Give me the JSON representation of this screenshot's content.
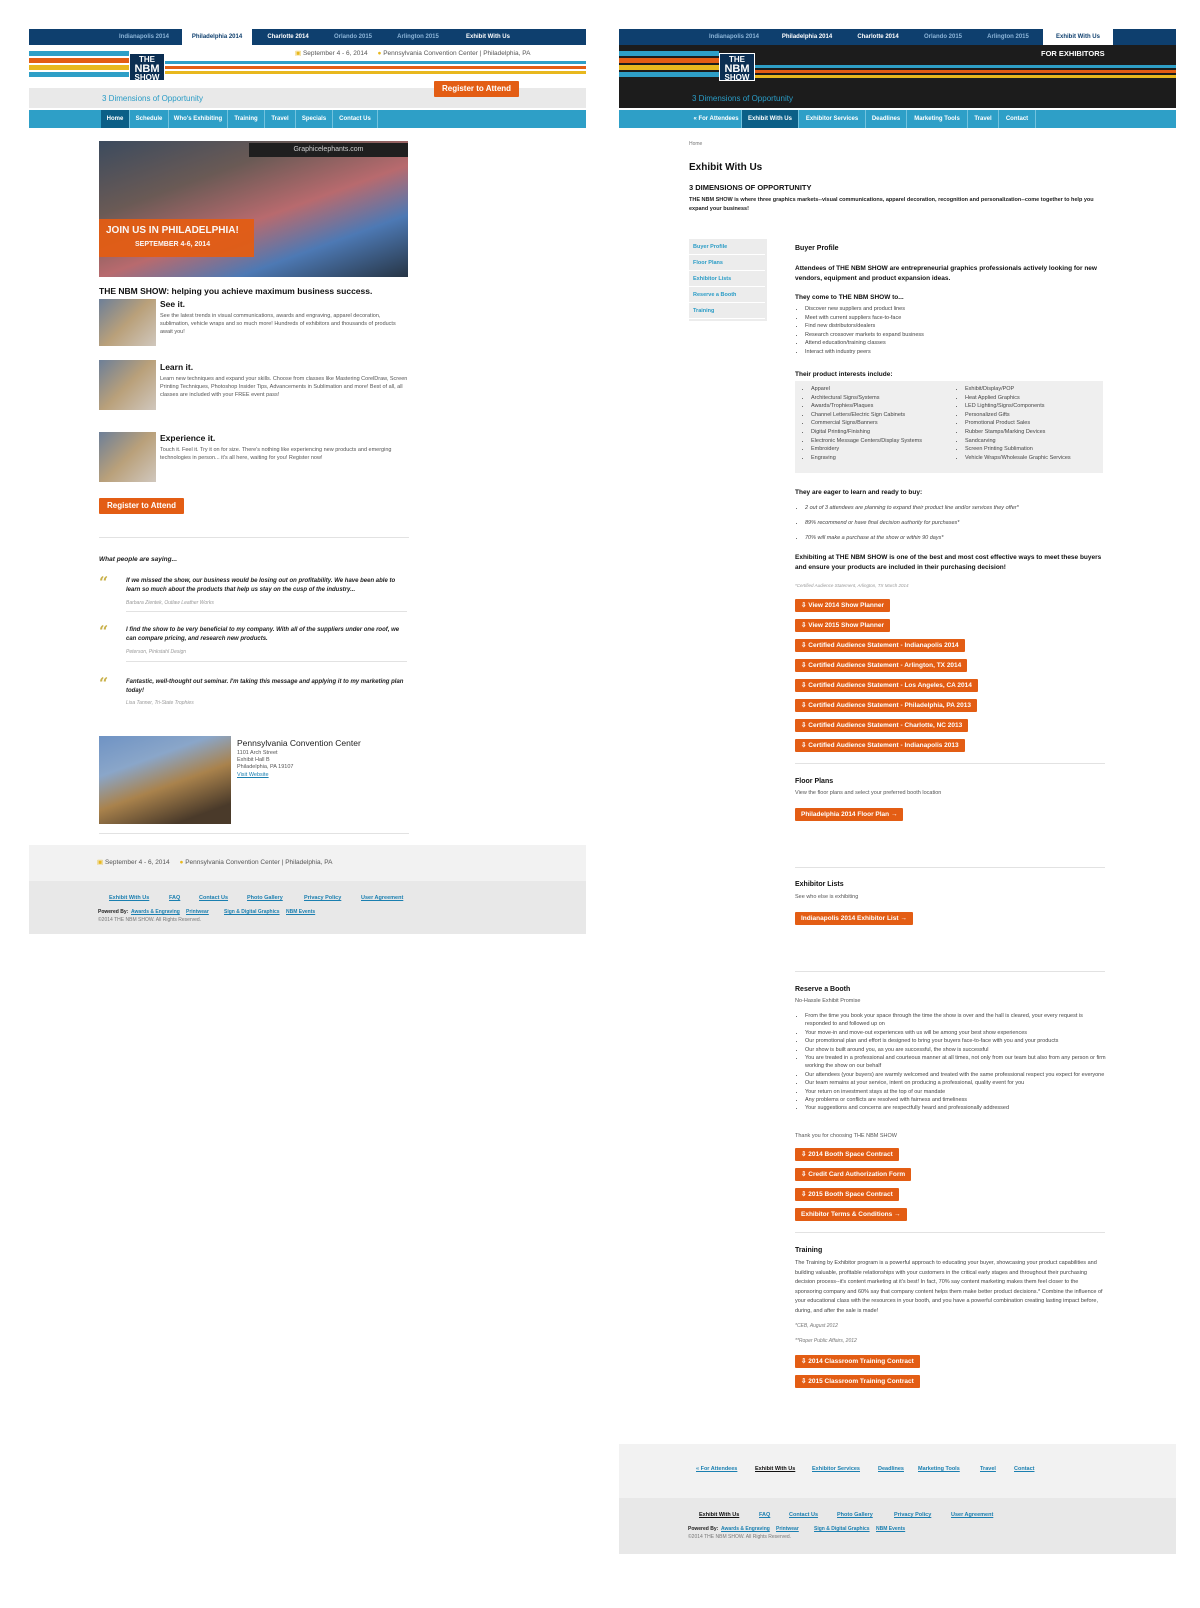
{
  "left": {
    "top_tabs": [
      "Indianapolis 2014",
      "Philadelphia 2014",
      "Charlotte 2014",
      "Orlando 2015",
      "Arlington 2015",
      "Exhibit With Us"
    ],
    "event_date": "September 4 - 6, 2014",
    "event_venue": "Pennsylvania Convention Center | Philadelphia, PA",
    "register_button": "Register to Attend",
    "tagline": "3 Dimensions of Opportunity",
    "nav": [
      "Home",
      "Schedule",
      "Who's Exhibiting",
      "Training",
      "Travel",
      "Specials",
      "Contact Us"
    ],
    "hero": {
      "line1": "JOIN US IN PHILADELPHIA!",
      "line2": "SEPTEMBER 4-6, 2014",
      "sign": "Graphicelephants.com"
    },
    "intro_heading": "THE NBM SHOW: helping you achieve maximum business success.",
    "features": [
      {
        "title": "See it.",
        "text": "See the latest trends in visual communications, awards and engraving, apparel decoration, sublimation, vehicle wraps and so much more! Hundreds of exhibitors and thousands of products await you!"
      },
      {
        "title": "Learn it.",
        "text": "Learn new techniques and expand your skills. Choose from classes like Mastering CorelDraw, Screen Printing Techniques, Photoshop Insider Tips, Advancements in Sublimation and more! Best of all, all classes are included with your FREE event pass!"
      },
      {
        "title": "Experience it.",
        "text": "Touch it. Feel it. Try it on for size. There's nothing like experiencing new products and emerging technologies in person... it's all here, waiting for you! Register now!"
      }
    ],
    "register_button_2": "Register to Attend",
    "testimonials_heading": "What people are saying...",
    "testimonials": [
      {
        "quote": "If we missed the show, our business would be losing out on profitability. We have been able to learn so much about the products that help us stay on the cusp of the industry...",
        "author": "Barbara Zientek, Outlaw Leather Works"
      },
      {
        "quote": "I find the show to be very beneficial to my company. With all of the suppliers under one roof, we can compare pricing, and research new products.",
        "author": "Peterson, Pinkstahl Design"
      },
      {
        "quote": "Fantastic, well-thought out seminar. I'm taking this message and applying it to my marketing plan today!",
        "author": "Lisa Tanner, Tri-State Trophies"
      }
    ],
    "venue": {
      "name": "Pennsylvania Convention Center",
      "address1": "1101 Arch Street",
      "address2": "Exhibit Hall B",
      "address3": "Philadelphia, PA 19107",
      "link": "Visit Website"
    },
    "footer_date": "September 4 - 6, 2014",
    "footer_venue": "Pennsylvania Convention Center | Philadelphia, PA",
    "footer_links": [
      "Exhibit With Us",
      "FAQ",
      "Contact Us",
      "Photo Gallery",
      "Privacy Policy",
      "User Agreement"
    ],
    "powered_by": "Powered By:",
    "powered_links": [
      "Awards & Engraving",
      "Printwear",
      "Sign & Digital Graphics",
      "NBM Events"
    ],
    "copyright": "©2014 THE NBM SHOW. All Rights Reserved."
  },
  "right": {
    "top_tabs": [
      "Indianapolis 2014",
      "Philadelphia 2014",
      "Charlotte 2014",
      "Orlando 2015",
      "Arlington 2015",
      "Exhibit With Us"
    ],
    "for_exhibitors": "FOR EXHIBITORS",
    "tagline": "3 Dimensions of Opportunity",
    "nav": [
      "« For Attendees",
      "Exhibit With Us",
      "Exhibitor Services",
      "Deadlines",
      "Marketing Tools",
      "Travel",
      "Contact"
    ],
    "breadcrumb": "Home",
    "page_title": "Exhibit With Us",
    "subtitle": "3 DIMENSIONS OF OPPORTUNITY",
    "intro": "THE NBM SHOW is where three graphics markets--visual communications, apparel decoration, recognition and personalization--come together to help you expand your business!",
    "sidebar": [
      "Buyer Profile",
      "Floor Plans",
      "Exhibitor Lists",
      "Reserve a Booth",
      "Training"
    ],
    "buyer_profile": {
      "heading": "Buyer Profile",
      "lead": "Attendees of THE NBM SHOW are entrepreneurial graphics professionals actively looking for new vendors, equipment and product expansion ideas.",
      "come_heading": "They come to THE NBM SHOW to...",
      "come_items": [
        "Discover new suppliers and product lines",
        "Meet with current suppliers face-to-face",
        "Find new distributors/dealers",
        "Research crossover markets to expand business",
        "Attend education/training classes",
        "Interact with industry peers"
      ],
      "interests_heading": "Their product interests include:",
      "interests_left": [
        "Apparel",
        "Architectural Signs/Systems",
        "Awards/Trophies/Plaques",
        "Channel Letters/Electric Sign Cabinets",
        "Commercial Signs/Banners",
        "Digital Printing/Finishing",
        "Electronic Message Centers/Display Systems",
        "Embroidery",
        "Engraving"
      ],
      "interests_right": [
        "Exhibit/Display/POP",
        "Heat Applied Graphics",
        "LED Lighting/Signs/Components",
        "Personalized Gifts",
        "Promotional Product Sales",
        "Rubber Stamps/Marking Devices",
        "Sandcarving",
        "Screen Printing Sublimation",
        "Vehicle Wraps/Wholesale Graphic Services"
      ],
      "eager_heading": "They are eager to learn and ready to buy:",
      "eager_items": [
        "2 out of 3 attendees are planning to expand their product line and/or services they offer*",
        "89% recommend or have final decision authority for purchases*",
        "70% will make a purchase at the show or within 90 days*"
      ],
      "closing": "Exhibiting at THE NBM SHOW is one of the best and most cost effective ways to meet these buyers and ensure your products are included in their purchasing decision!",
      "footnote": "*Certified Audience Statement, Arlington, TX March 2014",
      "buttons": [
        "View 2014 Show Planner",
        "View 2015 Show Planner",
        "Certified Audience Statement - Indianapolis 2014",
        "Certified Audience Statement - Arlington, TX 2014",
        "Certified Audience Statement - Los Angeles, CA 2014",
        "Certified Audience Statement - Philadelphia, PA 2013",
        "Certified Audience Statement - Charlotte, NC 2013",
        "Certified Audience Statement - Indianapolis 2013"
      ]
    },
    "floor_plans": {
      "heading": "Floor Plans",
      "text": "View the floor plans and select your preferred booth location",
      "button": "Philadelphia 2014 Floor Plan →"
    },
    "exhibitor_lists": {
      "heading": "Exhibitor Lists",
      "text": "See who else is exhibiting",
      "button": "Indianapolis 2014 Exhibitor List →"
    },
    "reserve": {
      "heading": "Reserve a Booth",
      "sub": "No-Hassle Exhibit Promise",
      "items": [
        "From the time you book your space through the time the show is over and the hall is cleared, your every request is responded to and followed up on",
        "Your move-in and move-out experiences with us will be among your best show experiences",
        "Our promotional plan and effort is designed to bring your buyers face-to-face with you and your products",
        "Our show is built around you, as you are successful, the show is successful",
        "You are treated in a professional and courteous manner at all times, not only from our team but also from any person or firm working the show on our behalf",
        "Our attendees (your buyers) are warmly welcomed and treated with the same professional respect you expect for everyone",
        "Our team remains at your service, intent on producing a professional, quality event for you",
        "Your return on investment stays at the top of our mandate",
        "Any problems or conflicts are resolved with fairness and timeliness",
        "Your suggestions and concerns are respectfully heard and professionally addressed"
      ],
      "thanks": "Thank you for choosing THE NBM SHOW",
      "buttons": [
        "2014 Booth Space Contract",
        "Credit Card Authorization Form",
        "2015 Booth Space Contract",
        "Exhibitor Terms & Conditions →"
      ]
    },
    "training": {
      "heading": "Training",
      "text": "The Training by Exhibitor program is a powerful approach to educating your buyer, showcasing your product capabilities and building valuable, profitable relationships with your customers in the critical early stages and throughout their purchasing decision process--it's content marketing at it's best! In fact, 70% say content marketing makes them feel closer to the sponsoring company and 60% say that company content helps them make better product decisions.* Combine the influence of your educational class with the resources in your booth, and you have a powerful combination creating lasting impact before, during, and after the sale is made!",
      "note1": "*CEB, August 2012",
      "note2": "**Roper Public Affairs, 2012",
      "buttons": [
        "2014 Classroom Training Contract",
        "2015 Classroom Training Contract"
      ]
    },
    "footer_nav": [
      "« For Attendees",
      "Exhibit With Us",
      "Exhibitor Services",
      "Deadlines",
      "Marketing Tools",
      "Travel",
      "Contact"
    ],
    "footer_links": [
      "Exhibit With Us",
      "FAQ",
      "Contact Us",
      "Photo Gallery",
      "Privacy Policy",
      "User Agreement"
    ],
    "powered_by": "Powered By:",
    "powered_links": [
      "Awards & Engraving",
      "Printwear",
      "Sign & Digital Graphics",
      "NBM Events"
    ],
    "copyright": "©2014 THE NBM SHOW. All Rights Reserved."
  },
  "colors": {
    "navy": "#0e3f6e",
    "teal": "#2e9fc7",
    "orange": "#e35d14",
    "yellow": "#e8b81e",
    "dark": "#1a1a1a"
  }
}
